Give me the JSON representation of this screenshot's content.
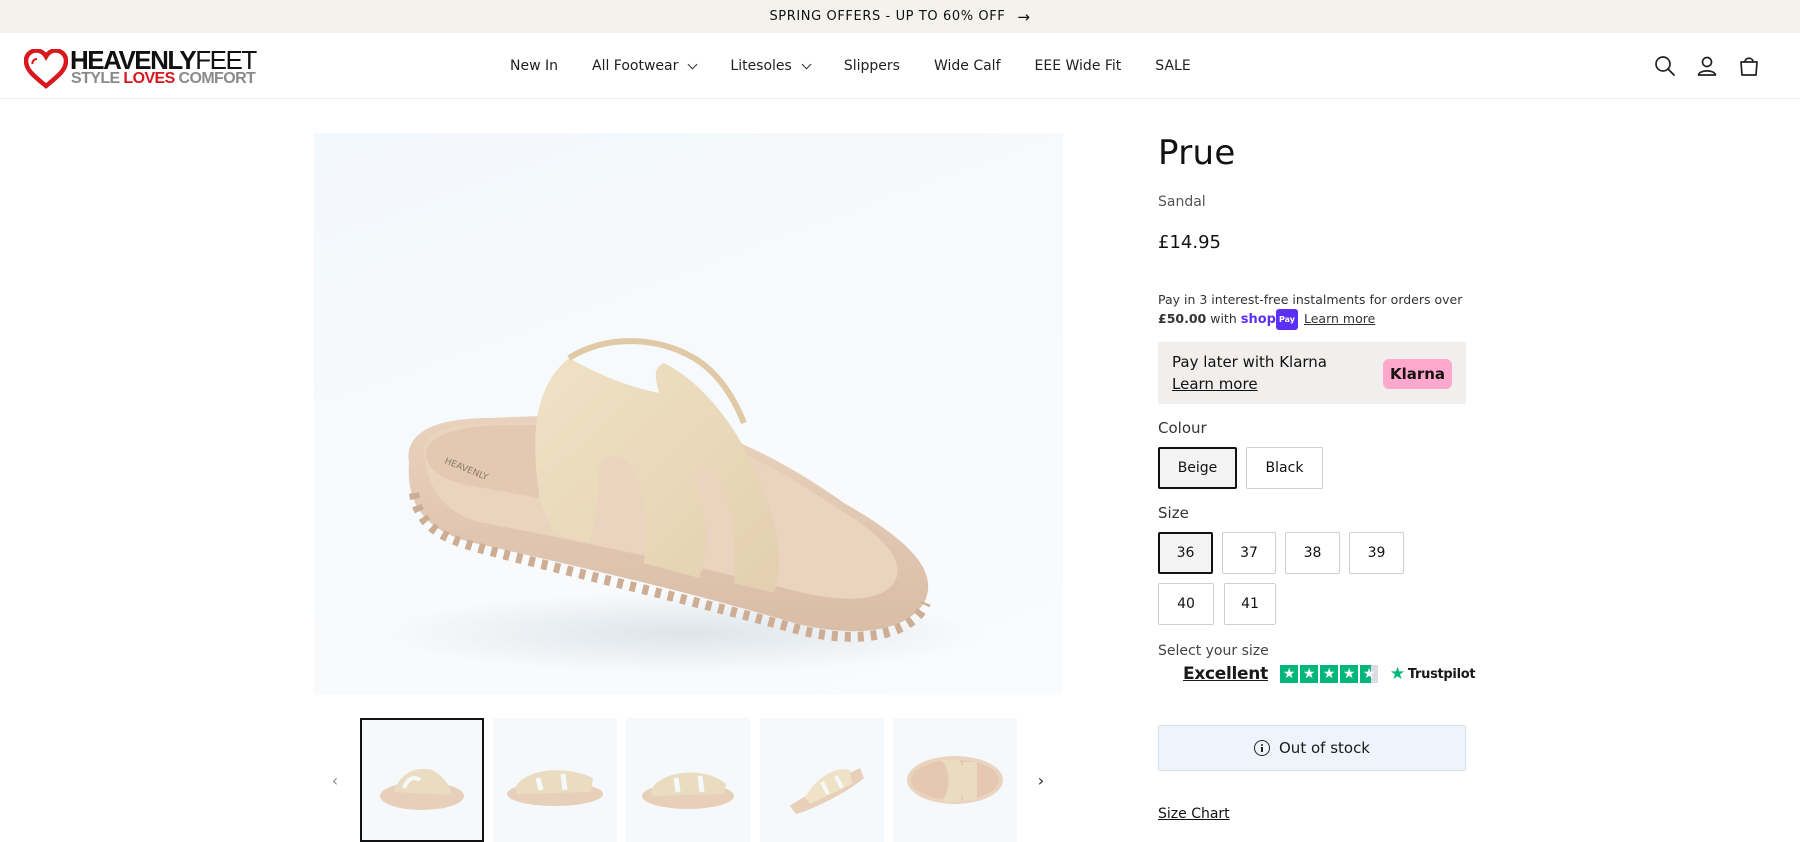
{
  "announcement": {
    "text": "SPRING OFFERS - UP TO 60% OFF",
    "arrow_icon": "arrow-right-icon"
  },
  "brand": {
    "line1_bold": "HEAVENLY",
    "line1_thin": "FEET",
    "line2_a": "STYLE ",
    "line2_b": "LOVES",
    "line2_c": " COMFORT",
    "accent_color": "#d7191e"
  },
  "nav": {
    "items": [
      {
        "label": "New In",
        "has_dropdown": false
      },
      {
        "label": "All Footwear",
        "has_dropdown": true
      },
      {
        "label": "Litesoles",
        "has_dropdown": true
      },
      {
        "label": "Slippers",
        "has_dropdown": false
      },
      {
        "label": "Wide Calf",
        "has_dropdown": false
      },
      {
        "label": "EEE Wide Fit",
        "has_dropdown": false
      },
      {
        "label": "SALE",
        "has_dropdown": false
      }
    ]
  },
  "header_icons": [
    "search-icon",
    "account-icon",
    "cart-icon"
  ],
  "gallery": {
    "thumbnail_count": 5,
    "active_thumbnail": 1,
    "prev_icon": "chevron-left-icon",
    "next_icon": "chevron-right-icon"
  },
  "product": {
    "title": "Prue",
    "vendor": "Sandal",
    "price": "£14.95",
    "shoppay": {
      "line1": "Pay in 3 interest-free instalments for orders over",
      "threshold": "£50.00",
      "with": "with",
      "logo_shop": "shop",
      "logo_pay": "Pay",
      "learn_more": "Learn more"
    },
    "klarna": {
      "title": "Pay later with Klarna",
      "learn_more": "Learn more",
      "badge": "Klarna",
      "badge_color": "#ffa8cd"
    },
    "colour": {
      "label": "Colour",
      "options": [
        "Beige",
        "Black"
      ],
      "selected": "Beige"
    },
    "size": {
      "label": "Size",
      "options": [
        "36",
        "37",
        "38",
        "39",
        "40",
        "41"
      ],
      "selected": "36"
    },
    "select_size_text": "Select your size",
    "trustpilot": {
      "rating_word": "Excellent",
      "stars": 4.5,
      "brand": "Trustpilot",
      "color": "#00b67a"
    },
    "stock_status": "Out of stock",
    "size_chart": "Size Chart"
  }
}
